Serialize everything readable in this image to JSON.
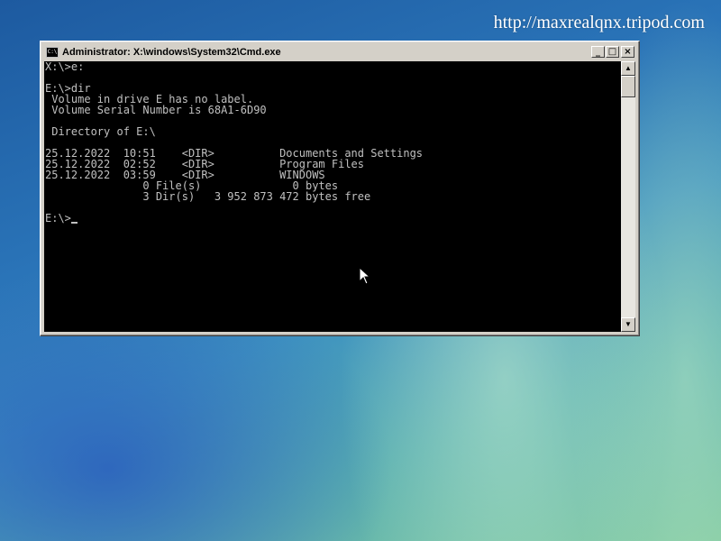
{
  "watermark": "http://maxrealqnx.tripod.com",
  "window": {
    "title": "Administrator: X:\\windows\\System32\\Cmd.exe",
    "icon": "cmd-icon",
    "icon_glyph": "C:\\",
    "buttons": {
      "minimize": "_",
      "maximize": "□",
      "close": "×"
    }
  },
  "console": {
    "lines": [
      "X:\\>e:",
      "",
      "E:\\>dir",
      " Volume in drive E has no label.",
      " Volume Serial Number is 68A1-6D90",
      "",
      " Directory of E:\\",
      "",
      "25.12.2022  10:51    <DIR>          Documents and Settings",
      "25.12.2022  02:52    <DIR>          Program Files",
      "25.12.2022  03:59    <DIR>          WINDOWS",
      "               0 File(s)              0 bytes",
      "               3 Dir(s)   3 952 873 472 bytes free",
      "",
      "E:\\>"
    ]
  },
  "scrollbar": {
    "up_arrow": "▲",
    "down_arrow": "▼"
  },
  "colors": {
    "console_bg": "#000000",
    "console_text": "#c0c0c0",
    "window_chrome": "#d4d0c8"
  }
}
